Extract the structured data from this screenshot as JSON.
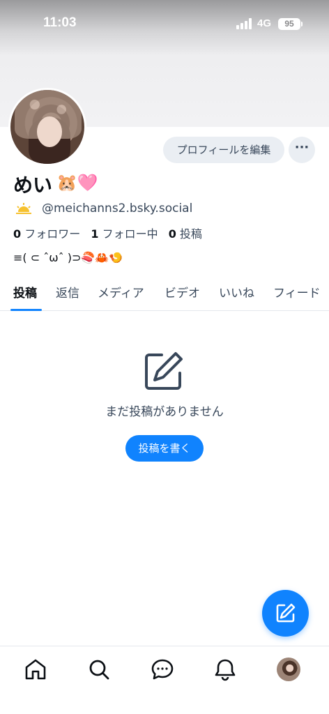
{
  "status_bar": {
    "time": "11:03",
    "network": "4G",
    "battery": "95"
  },
  "profile": {
    "display_name": "めい",
    "display_emoji": "🐹🩷",
    "handle": "@meichanns2.bsky.social",
    "edit_button": "プロフィールを編集",
    "more_button": "···",
    "stats": {
      "followers_count": "0",
      "followers_label": "フォロワー",
      "following_count": "1",
      "following_label": "フォロー中",
      "posts_count": "0",
      "posts_label": "投稿"
    },
    "bio": "≡( ⊂ ˆωˆ )⊃🍣🦀🍤"
  },
  "tabs": [
    {
      "label": "投稿",
      "active": true
    },
    {
      "label": "返信"
    },
    {
      "label": "メディア"
    },
    {
      "label": "ビデオ"
    },
    {
      "label": "いいね"
    },
    {
      "label": "フィード"
    }
  ],
  "empty_state": {
    "message": "まだ投稿がありません",
    "button": "投稿を書く"
  },
  "bottom_nav": [
    "home-icon",
    "search-icon",
    "chat-icon",
    "bell-icon",
    "profile-avatar"
  ],
  "colors": {
    "accent": "#1083fe",
    "text_primary": "#0b0f14",
    "text_secondary": "#38475a",
    "button_bg": "#eaeef3"
  }
}
